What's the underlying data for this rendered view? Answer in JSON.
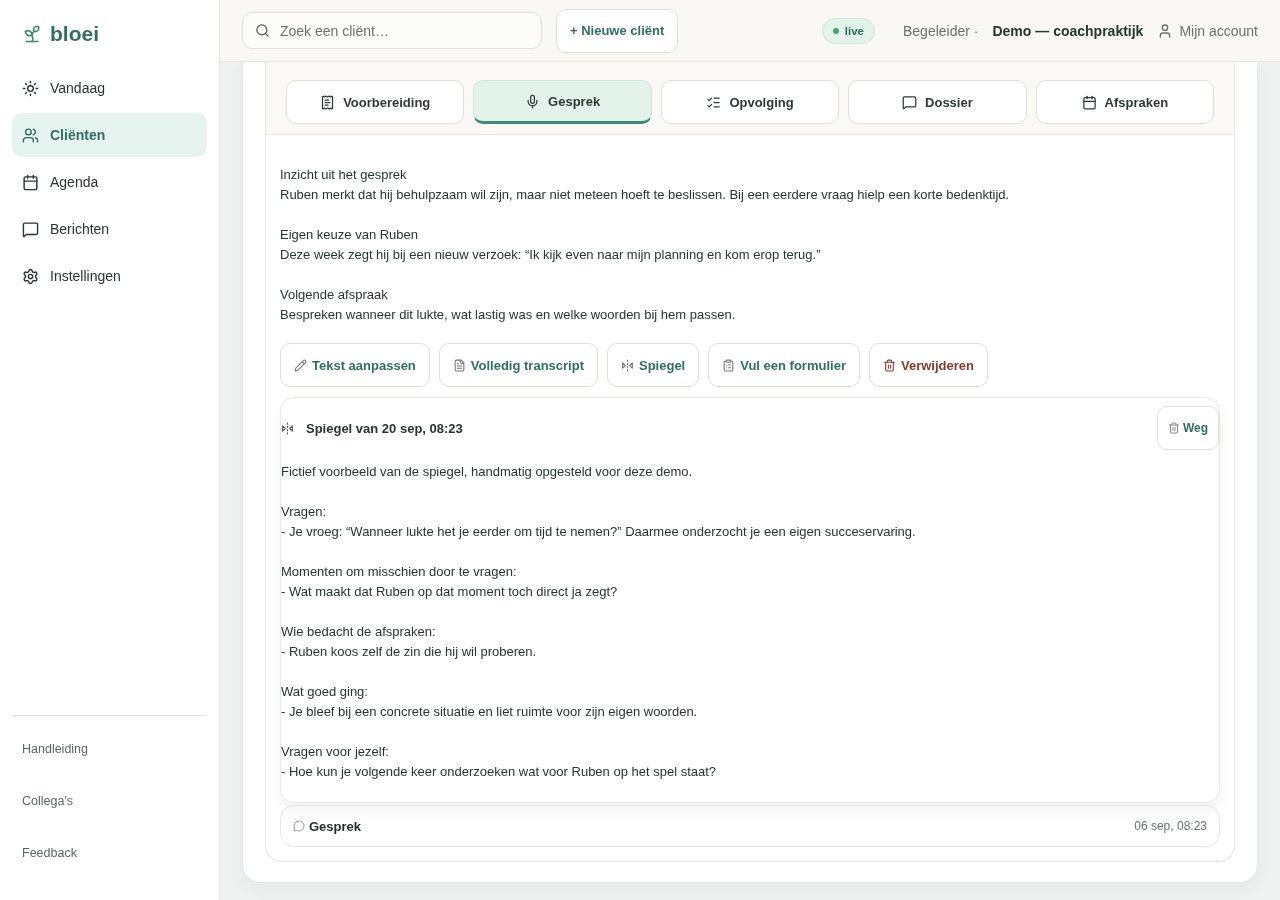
{
  "brand": {
    "name": "bloei"
  },
  "sidebar": {
    "items": [
      {
        "label": "Vandaag",
        "selected": false
      },
      {
        "label": "Cliënten",
        "selected": true
      },
      {
        "label": "Agenda",
        "selected": false
      },
      {
        "label": "Berichten",
        "selected": false
      },
      {
        "label": "Instellingen",
        "selected": false
      }
    ],
    "footer_links": [
      "Handleiding",
      "Collega's",
      "Feedback"
    ]
  },
  "topbar": {
    "search": {
      "placeholder": "Zoek een cliënt…"
    },
    "new_button": "+ Nieuwe cliënt",
    "status": "live",
    "role": "Begeleider ·",
    "org": "Demo — coachpraktijk",
    "account": "Mijn account"
  },
  "tabs": [
    {
      "label": "Voorbereiding",
      "selected": false
    },
    {
      "label": "Gesprek",
      "selected": true
    },
    {
      "label": "Opvolging",
      "selected": false
    },
    {
      "label": "Dossier",
      "selected": false
    },
    {
      "label": "Afspraken",
      "selected": false
    }
  ],
  "summary": [
    {
      "heading": "Inzicht uit het gesprek",
      "text": "Ruben merkt dat hij behulpzaam wil zijn, maar niet meteen hoeft te beslissen. Bij een eerdere vraag hielp een korte bedenktijd."
    },
    {
      "heading": "Eigen keuze van Ruben",
      "text": "Deze week zegt hij bij een nieuw verzoek: “Ik kijk even naar mijn planning en kom erop terug.”"
    },
    {
      "heading": "Volgende afspraak",
      "text": "Bespreken wanneer dit lukte, wat lastig was en welke woorden bij hem passen."
    }
  ],
  "actions": [
    {
      "label": "Tekst aanpassen",
      "kind": "normal"
    },
    {
      "label": "Volledig transcript",
      "kind": "normal"
    },
    {
      "label": "Spiegel",
      "kind": "normal"
    },
    {
      "label": "Vul een formulier",
      "kind": "normal"
    },
    {
      "label": "Verwijderen",
      "kind": "danger"
    }
  ],
  "mirror": {
    "title": "Spiegel van 20 sep, 08:23",
    "remove_button": "Weg",
    "intro": "Fictief voorbeeld van de spiegel, handmatig opgesteld voor deze demo.",
    "sections": [
      {
        "heading": "Vragen:",
        "text": "- Je vroeg: “Wanneer lukte het je eerder om tijd te nemen?” Daarmee onderzocht je een eigen succeservaring."
      },
      {
        "heading": "Momenten om misschien door te vragen:",
        "text": "- Wat maakt dat Ruben op dat moment toch direct ja zegt?"
      },
      {
        "heading": "Wie bedacht de afspraken:",
        "text": "- Ruben koos zelf de zin die hij wil proberen."
      },
      {
        "heading": "Wat goed ging:",
        "text": "- Je bleef bij een concrete situatie en liet ruimte voor zijn eigen woorden."
      },
      {
        "heading": "Vragen voor jezelf:",
        "text": "- Hoe kun je volgende keer onderzoeken wat voor Ruben op het spel staat?"
      }
    ]
  },
  "entries": [
    {
      "title": "Gesprek",
      "date": "06 sep, 08:23"
    }
  ]
}
